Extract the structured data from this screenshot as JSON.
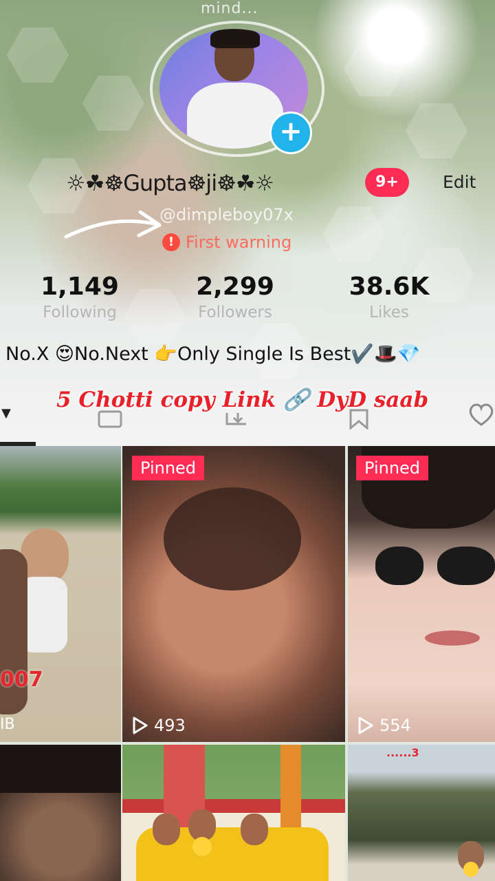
{
  "header": {
    "top_text": "mind...",
    "name": "☼☘☸Gupta☸ji☸☘☼",
    "notification_badge": "9+",
    "edit_label": "Edit",
    "username": "@dimpleboy07x",
    "warning": "First warning"
  },
  "stats": [
    {
      "value": "1,149",
      "label": "Following"
    },
    {
      "value": "2,299",
      "label": "Followers"
    },
    {
      "value": "38.6K",
      "label": "Likes"
    }
  ],
  "bio": "No.X 😍No.Next 👉Only Single Is Best✔️🎩💎",
  "overlay_text": "5 Chotti copy Link 🔗 DyD saab",
  "tabs": {
    "icons": [
      "videos-tab-icon",
      "private-tab-icon",
      "reposts-tab-icon",
      "saved-tab-icon",
      "liked-tab-icon"
    ]
  },
  "videos": [
    {
      "pinned": "",
      "views": "",
      "overlay": "007",
      "corner": "IB"
    },
    {
      "pinned": "Pinned",
      "views": "493"
    },
    {
      "pinned": "Pinned",
      "views": "554"
    },
    {
      "pinned": "",
      "views": ""
    },
    {
      "pinned": "",
      "views": ""
    },
    {
      "pinned": "",
      "views": "",
      "overlay": "......3"
    }
  ],
  "colors": {
    "accent": "#fe2c55",
    "plus_button": "#21b3ea",
    "overlay_text": "#e8212a"
  }
}
